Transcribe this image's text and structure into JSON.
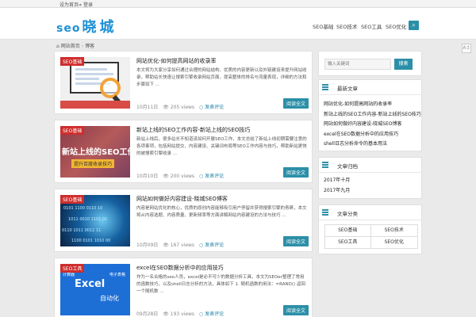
{
  "topbar": {
    "link1": "设为首页",
    "link2": "登录",
    "login_icon": "login-icon"
  },
  "header": {
    "logo_seo": "seo",
    "logo_cn": "晓城",
    "nav": [
      "SEO基础",
      "SEO技术",
      "SEO工具",
      "SEO优化"
    ],
    "search_icon": "search-icon"
  },
  "breadcrumb": {
    "home": "网站首页",
    "current": "博客",
    "home_icon": "home-icon"
  },
  "posts": [
    {
      "category": "SEO基础",
      "title": "网站优化-如何提高网站的收录率",
      "excerpt": "本文将为大家分享如何通过合理的网站结构、优质的内容更新以及外链建设来提升网站收录，帮助站长快速让搜索引擎收录网站页面，提高整体的排名与流量表现，详细的方法和步骤如下 ...",
      "date": "10月11日",
      "views": "205 views",
      "comments": "发表评论",
      "more": "阅读全文"
    },
    {
      "category": "SEO基础",
      "title": "新站上线的SEO工作内容-新站上线的SEO技巧",
      "excerpt": "新站上线后，很多站长不知道该如何开展SEO工作，本文总结了新站上线初期需要注意的各项事项，包括网站提交、内容建设、关键词布局等SEO工作内容与技巧，帮助新站更快的被搜索引擎收录 ...",
      "date": "10月10日",
      "views": "200 views",
      "comments": "发表评论",
      "more": "阅读全文"
    },
    {
      "category": "SEO基础",
      "title": "网站如何做好内容建设-晓城SEO博客",
      "excerpt": "内容是网站优化的核心，优质的原创内容能够吸引用户停留并获得搜索引擎的青睐，本文将从内容选题、内容质量、更新频率等方面讲解网站内容建设的方法与技巧 ...",
      "date": "10月09日",
      "views": "167 views",
      "comments": "发表评论",
      "more": "阅读全文"
    },
    {
      "category": "SEO工具",
      "title": "excel在SEO数据分析中的应用技巧",
      "excerpt": "作为一名合格的seo人员，excel是必不可少的数据分析工具，本文为SEOer整理了常用的函数技巧，以及shell日志分析的方法，具体如下 1. 随机函数的用法：=RAND() 返回一个随机数 ...",
      "date": "09月28日",
      "views": "193 views",
      "comments": "发表评论",
      "more": "阅读全文"
    }
  ],
  "thumbs": {
    "t2_big": "新站上线的SEO工作",
    "t2_small": "提升百度收录技巧",
    "t4_tl": "计算器",
    "t4_tr": "电子表格",
    "t4_excel": "Excel",
    "t4_auto": "自动化"
  },
  "sidebar": {
    "search_placeholder": "输入关键词",
    "search_button": "搜索",
    "latest_title": "最新文章",
    "latest": [
      "网站优化-如何提高网站的收录率",
      "新站上线的SEO工作内容-新站上线的SEO技巧",
      "网站如何做好内容建设-晓城SEO博客",
      "excel在SEO数据分析中的应用技巧",
      "shell日志分析命令的基本用法"
    ],
    "archive_title": "文章归档",
    "archive": [
      "2017年十月",
      "2017年九月"
    ],
    "cats_title": "文章分类",
    "cats": [
      "SEO基础",
      "SEO技术",
      "SEO工具",
      "SEO优化"
    ]
  },
  "colors": {
    "accent": "#2c8fa8",
    "logo": "#1e90d6",
    "badge": "#cf2d2d"
  }
}
